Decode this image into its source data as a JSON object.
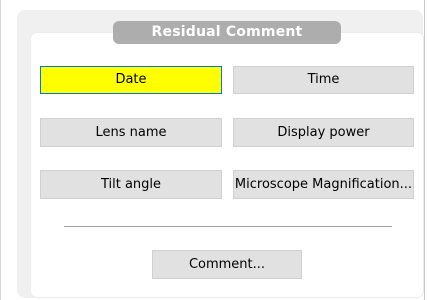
{
  "panel": {
    "title": "Residual Comment"
  },
  "buttons": {
    "date": "Date",
    "time": "Time",
    "lens_name": "Lens name",
    "display_power": "Display power",
    "tilt_angle": "Tilt angle",
    "microscope_magnification": "Microscope Magnification...",
    "comment": "Comment..."
  },
  "colors": {
    "selected_fill": "#ffff00",
    "selected_border": "#0078d7",
    "button_fill": "#e1e1e1",
    "title_badge": "#adadad"
  }
}
